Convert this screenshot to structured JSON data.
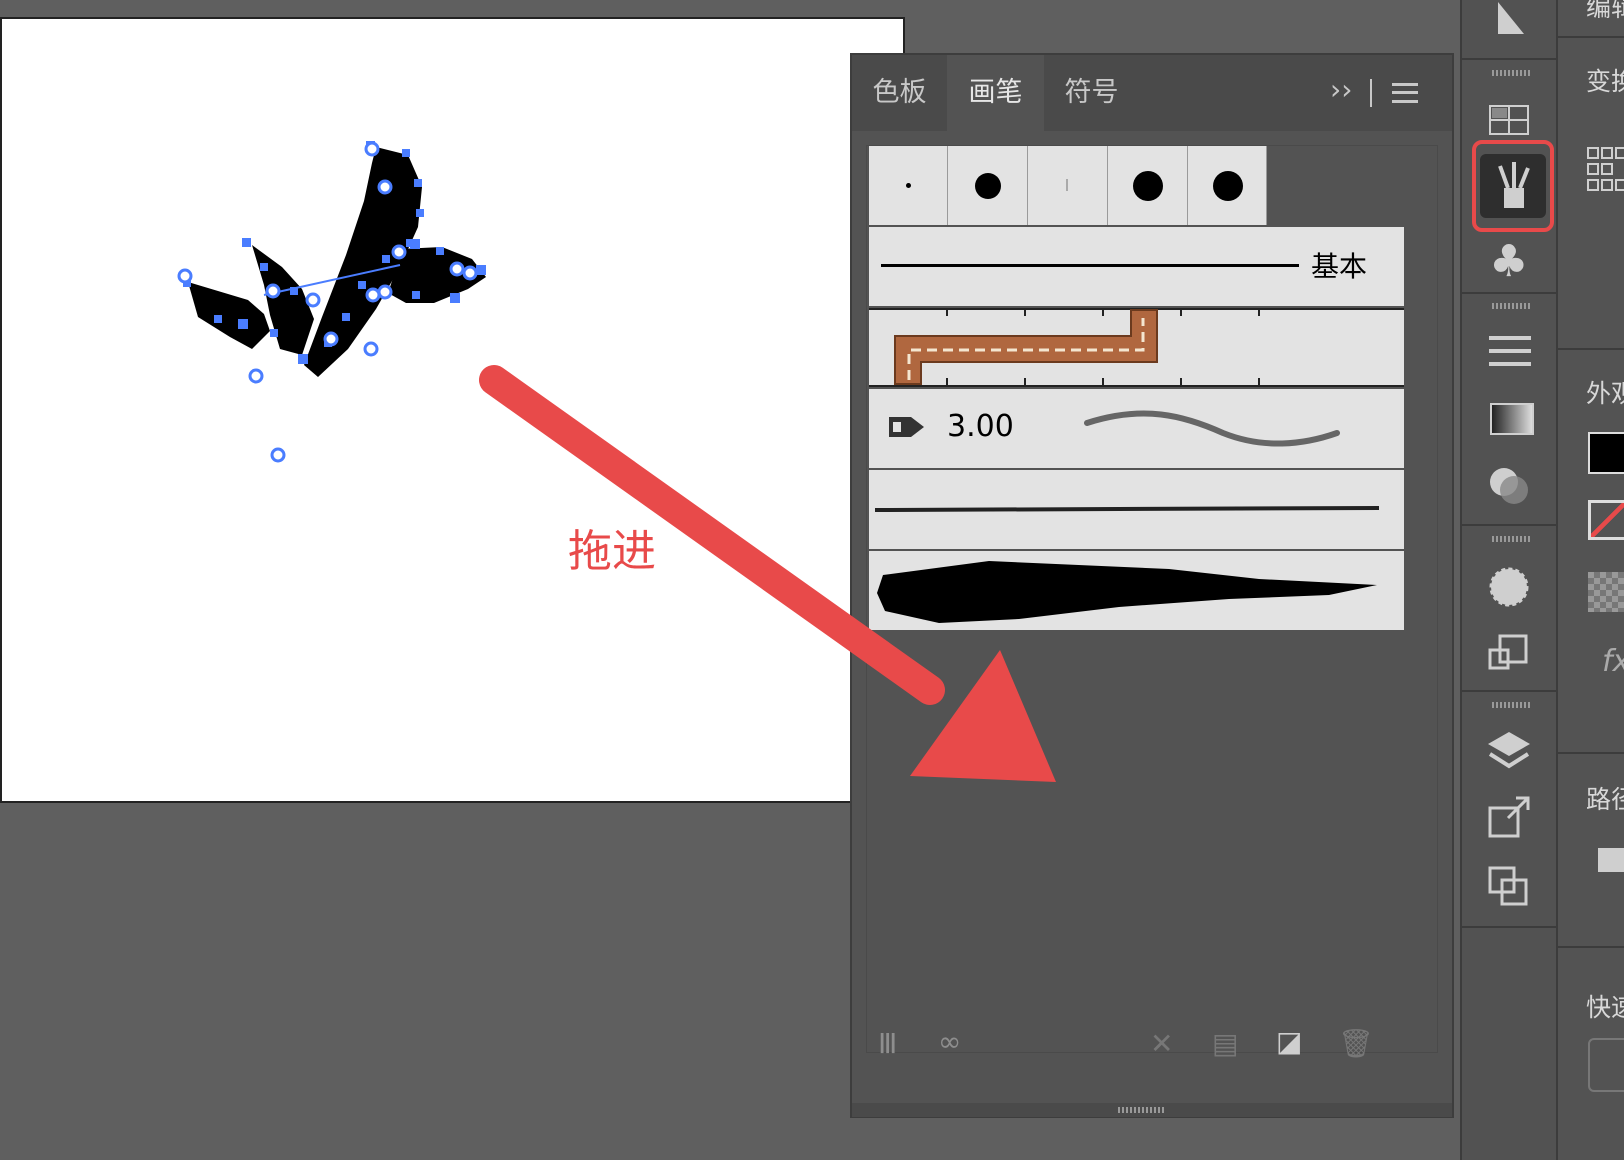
{
  "panel": {
    "tabs": [
      {
        "label": "色板"
      },
      {
        "label": "画笔"
      },
      {
        "label": "符号"
      }
    ],
    "active_tab": "画笔",
    "brushes": {
      "basic_label": "基本",
      "calligraphic_size": "3.00"
    }
  },
  "annotation": {
    "text": "拖进",
    "color": "#e84a4a"
  },
  "properties": {
    "labels": [
      "编辑",
      "变换",
      "外观",
      "路径",
      "快速"
    ],
    "fx": "fx"
  },
  "colors": {
    "highlight": "#e84a4a",
    "selection": "#4a7dff",
    "panel_bg": "#535353"
  }
}
